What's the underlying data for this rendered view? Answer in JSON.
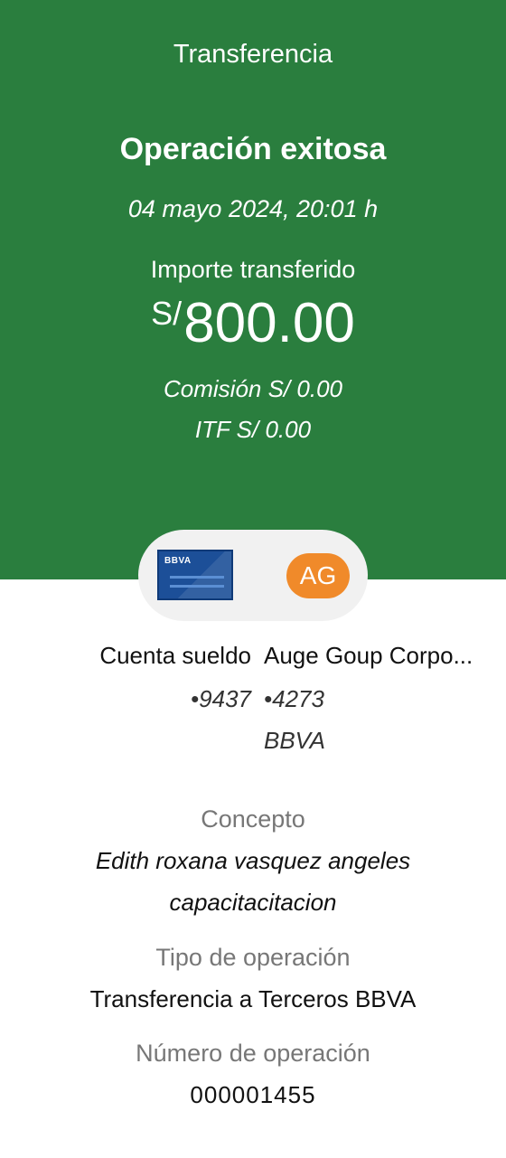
{
  "header": {
    "screen_title": "Transferencia",
    "status_title": "Operación exitosa",
    "datetime": "04 mayo 2024,  20:01 h",
    "amount_label": "Importe transferido",
    "currency": "S/",
    "amount": "800.00",
    "commission": "Comisión  S/ 0.00",
    "itf": "ITF  S/ 0.00"
  },
  "parties": {
    "bank_logo": "BBVA",
    "avatar_initials": "AG",
    "origin_name": "Cuenta sueldo",
    "origin_number": "•9437",
    "destination_name": "Auge Goup Corpo...",
    "destination_number": "•4273",
    "destination_bank": "BBVA"
  },
  "details": {
    "concept_label": "Concepto",
    "concept_line1": "Edith roxana vasquez angeles",
    "concept_line2": "capacitacitacion",
    "operation_type_label": "Tipo de operación",
    "operation_type": "Transferencia a Terceros BBVA",
    "operation_number_label": "Número de operación",
    "operation_number": "000001455"
  },
  "colors": {
    "header_green": "#2a7e3e",
    "avatar_orange": "#f08a2a",
    "card_blue": "#1c4f98"
  },
  "icons": {
    "source_account": "bbva-card-icon",
    "destination_account": "initials-avatar"
  }
}
